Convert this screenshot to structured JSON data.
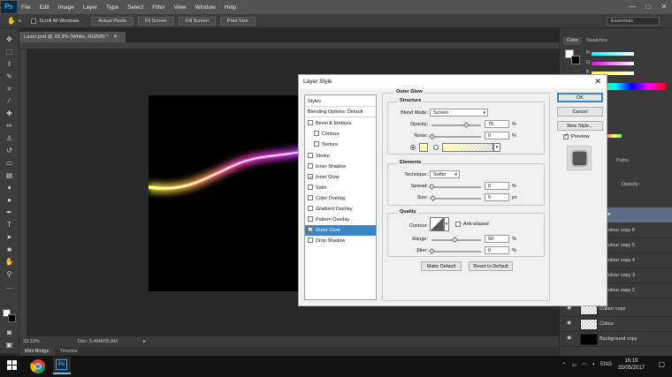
{
  "app": {
    "logo": "Ps"
  },
  "menu": [
    "File",
    "Edit",
    "Image",
    "Layer",
    "Type",
    "Select",
    "Filter",
    "View",
    "Window",
    "Help"
  ],
  "window_controls": [
    "—",
    "□",
    "✕"
  ],
  "options_bar": {
    "scroll_all_windows": "Scroll All Windows",
    "buttons": [
      "Actual Pixels",
      "Fit Screen",
      "Fill Screen",
      "Print Size"
    ],
    "workspace": "Essentials"
  },
  "document": {
    "tab_title": "Laser.psd @ 33.3% (White, RGB/8) *",
    "zoom": "33.33%",
    "doc_size": "Doc: 5.49M/35.8M"
  },
  "bottom_tabs": [
    "Mini Bridge",
    "Timeline"
  ],
  "right_panel": {
    "color_tabs": [
      "Color",
      "Swatches"
    ],
    "channels": [
      "R",
      "G",
      "B"
    ],
    "paths_tab": "Paths",
    "opacity_label": "Opacity:",
    "layers": [
      {
        "name": "Colour copy 6"
      },
      {
        "name": "Colour copy 5"
      },
      {
        "name": "Colour copy 4"
      },
      {
        "name": "Colour copy 3"
      },
      {
        "name": "Colour copy 2"
      },
      {
        "name": "Colour copy"
      },
      {
        "name": "Colour"
      },
      {
        "name": "Background copy"
      }
    ],
    "selected_layer_partial": "ite"
  },
  "taskbar": {
    "language": "ENG",
    "time": "16:19",
    "date": "25/05/2017"
  },
  "dialog": {
    "title": "Layer Style",
    "styles_header": "Styles",
    "blending_options": "Blending Options: Default",
    "style_items": [
      {
        "label": "Bevel & Emboss",
        "checked": false,
        "indent": false
      },
      {
        "label": "Contour",
        "checked": false,
        "indent": true
      },
      {
        "label": "Texture",
        "checked": false,
        "indent": true
      },
      {
        "label": "Stroke",
        "checked": false,
        "indent": false
      },
      {
        "label": "Inner Shadow",
        "checked": false,
        "indent": false
      },
      {
        "label": "Inner Glow",
        "checked": true,
        "indent": false
      },
      {
        "label": "Satin",
        "checked": false,
        "indent": false
      },
      {
        "label": "Color Overlay",
        "checked": false,
        "indent": false
      },
      {
        "label": "Gradient Overlay",
        "checked": false,
        "indent": false
      },
      {
        "label": "Pattern Overlay",
        "checked": false,
        "indent": false
      },
      {
        "label": "Outer Glow",
        "checked": true,
        "indent": false,
        "selected": true
      },
      {
        "label": "Drop Shadow",
        "checked": false,
        "indent": false
      }
    ],
    "section_title": "Outer Glow",
    "structure": {
      "title": "Structure",
      "blend_mode_label": "Blend Mode:",
      "blend_mode": "Screen",
      "opacity_label": "Opacity:",
      "opacity": "75",
      "opacity_fraction": 0.75,
      "noise_label": "Noise:",
      "noise": "0",
      "noise_fraction": 0.0,
      "unit": "%",
      "glow_color": "#ffffbe"
    },
    "elements": {
      "title": "Elements",
      "technique_label": "Technique:",
      "technique": "Softer",
      "spread_label": "Spread:",
      "spread": "0",
      "spread_fraction": 0.0,
      "spread_unit": "%",
      "size_label": "Size:",
      "size": "5",
      "size_fraction": 0.02,
      "size_unit": "px"
    },
    "quality": {
      "title": "Quality",
      "contour_label": "Contour:",
      "anti_aliased": "Anti-aliased",
      "range_label": "Range:",
      "range": "50",
      "range_fraction": 0.5,
      "range_unit": "%",
      "jitter_label": "Jitter:",
      "jitter": "0",
      "jitter_fraction": 0.0,
      "jitter_unit": "%"
    },
    "make_default": "Make Default",
    "reset_to_default": "Reset to Default",
    "ok": "OK",
    "cancel": "Cancel",
    "new_style": "New Style...",
    "preview": "Preview",
    "preview_checked": true
  },
  "colors": {
    "accent": "#3c84c8",
    "ps_blue": "#31a8ff"
  }
}
